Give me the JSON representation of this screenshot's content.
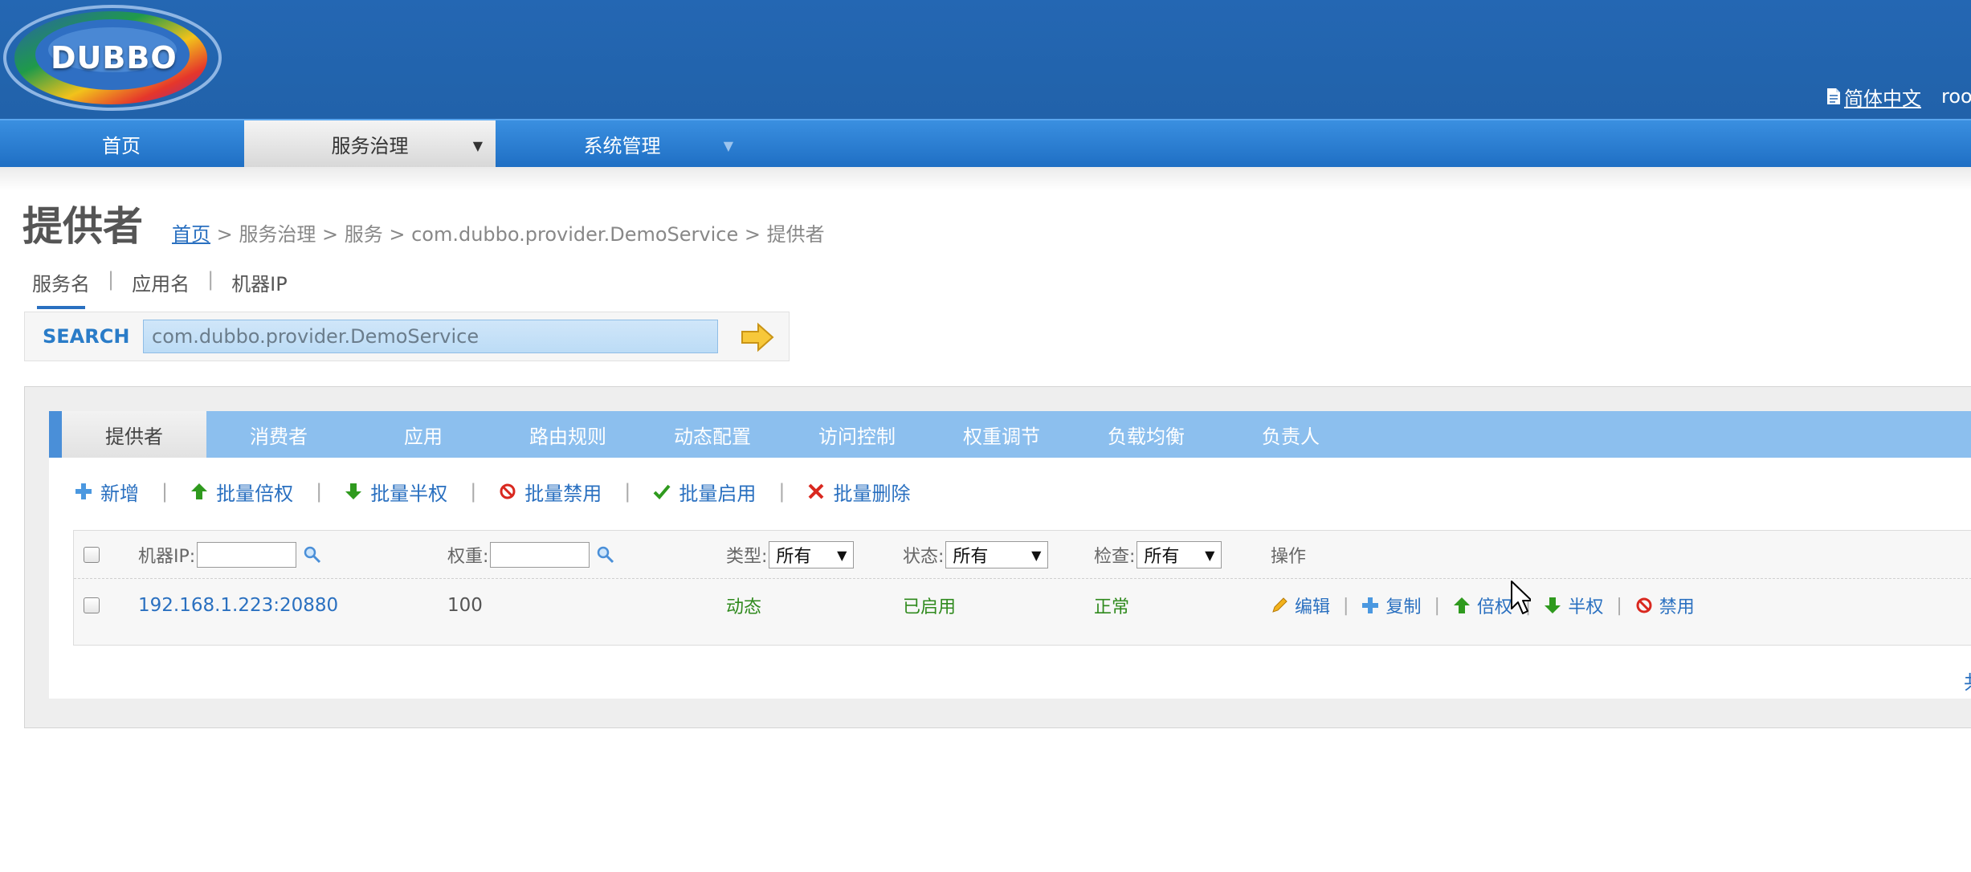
{
  "header": {
    "logo_text": "DUBBO",
    "language": "简体中文",
    "user": "root"
  },
  "nav": {
    "items": [
      {
        "label": "首页"
      },
      {
        "label": "服务治理"
      },
      {
        "label": "系统管理"
      }
    ]
  },
  "page": {
    "title": "提供者",
    "breadcrumb": {
      "home": "首页",
      "rest": " > 服务治理 > 服务 > com.dubbo.provider.DemoService > 提供者"
    }
  },
  "search": {
    "types": [
      {
        "label": "服务名"
      },
      {
        "label": "应用名"
      },
      {
        "label": "机器IP"
      }
    ],
    "label": "SEARCH",
    "value": "com.dubbo.provider.DemoService"
  },
  "tabs": [
    {
      "label": "提供者"
    },
    {
      "label": "消费者"
    },
    {
      "label": "应用"
    },
    {
      "label": "路由规则"
    },
    {
      "label": "动态配置"
    },
    {
      "label": "访问控制"
    },
    {
      "label": "权重调节"
    },
    {
      "label": "负载均衡"
    },
    {
      "label": "负责人"
    }
  ],
  "actions": [
    {
      "label": "新增",
      "icon": "plus-icon"
    },
    {
      "label": "批量倍权",
      "icon": "arrow-up-icon"
    },
    {
      "label": "批量半权",
      "icon": "arrow-down-icon"
    },
    {
      "label": "批量禁用",
      "icon": "ban-icon"
    },
    {
      "label": "批量启用",
      "icon": "check-icon"
    },
    {
      "label": "批量删除",
      "icon": "x-icon"
    }
  ],
  "table": {
    "headers": {
      "ip": "机器IP:",
      "weight": "权重:",
      "type": "类型:",
      "type_value": "所有",
      "status": "状态:",
      "status_value": "所有",
      "check": "检查:",
      "check_value": "所有",
      "ops": "操作"
    },
    "rows": [
      {
        "address": "192.168.1.223:20880",
        "weight": "100",
        "type": "动态",
        "status": "已启用",
        "check": "正常",
        "ops": [
          "编辑",
          "复制",
          "倍权",
          "半权",
          "禁用"
        ]
      }
    ]
  },
  "pager": {
    "text": "共"
  },
  "colors": {
    "header_bg": "#2467b3",
    "nav_bg": "#2a7cd0",
    "tab_bar": "#8cbfee",
    "link": "#2a70c0",
    "ok_green": "#2f8a1d"
  }
}
